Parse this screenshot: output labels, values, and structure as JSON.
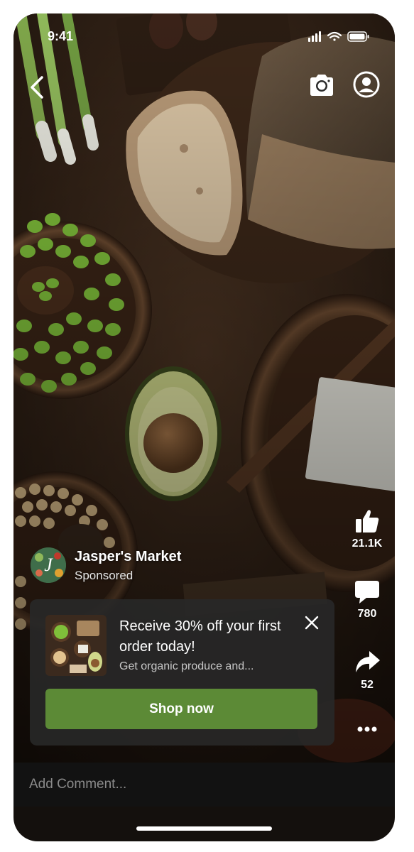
{
  "status_bar": {
    "time": "9:41",
    "icons": [
      "signal-icon",
      "wifi-icon",
      "battery-icon"
    ]
  },
  "top_bar": {
    "icons": [
      "back-icon",
      "camera-icon",
      "profile-icon"
    ]
  },
  "actions": {
    "like_count": "21.1K",
    "comment_count": "780",
    "share_count": "52"
  },
  "brand": {
    "name": "Jasper's Market",
    "sponsored": "Sponsored",
    "logo_letter": "J"
  },
  "ad": {
    "title": "Receive 30% off your first order today!",
    "subtitle": "Get organic produce and...",
    "cta": "Shop now"
  },
  "comment": {
    "placeholder": "Add Comment..."
  },
  "colors": {
    "cta_green": "#5c8a36",
    "card_bg": "#282828",
    "background": "#3b2a1e"
  }
}
